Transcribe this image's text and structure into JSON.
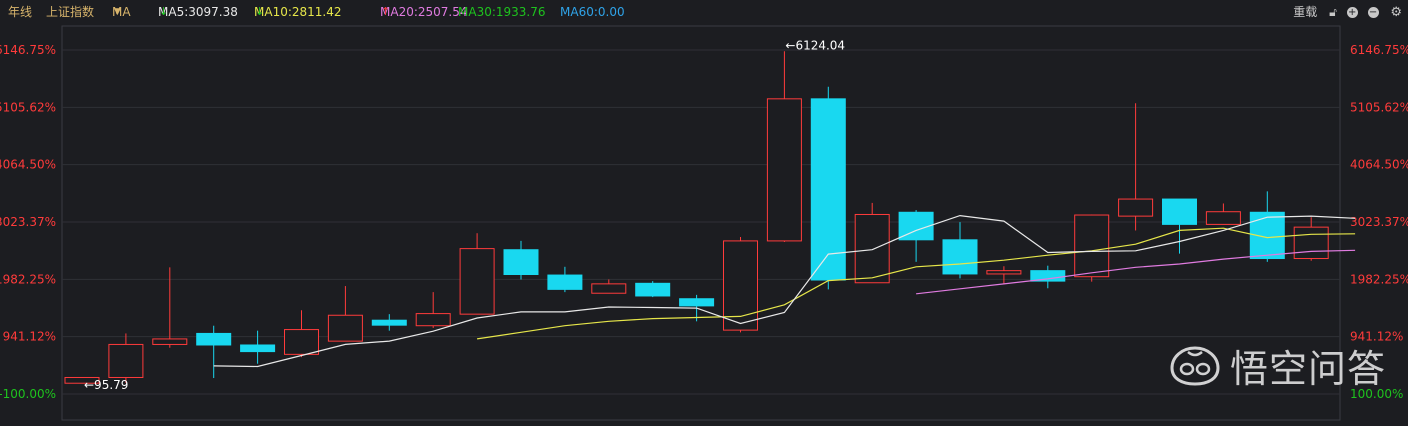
{
  "topbar": {
    "period": "年线",
    "index_name": "上证指数",
    "ma_select": "MA",
    "ma": [
      {
        "label": "MA5:3097.38",
        "arrow": "↓",
        "color": "#e8e8e8",
        "arrow_color": "#1ec31e"
      },
      {
        "label": "MA10:2811.42",
        "arrow": "↓",
        "color": "#e6e64a",
        "arrow_color": "#1ec31e"
      },
      {
        "label": "MA20:2507.54",
        "arrow": "↑",
        "color": "#e07be0",
        "arrow_color": "#ff3b3b"
      },
      {
        "label": "MA30:1933.76",
        "arrow": "",
        "color": "#1ec31e",
        "arrow_color": ""
      },
      {
        "label": "MA60:0.00",
        "arrow": "",
        "color": "#2fa3e8",
        "arrow_color": ""
      }
    ],
    "tools": {
      "reset": "重载",
      "lock_icon": "lock-icon",
      "zoom_in": "+",
      "zoom_out": "−",
      "settings_icon": "gear-icon"
    }
  },
  "watermark": "悟空问答",
  "chart_data": {
    "type": "candlestick",
    "y_ticks": [
      "6146.75%",
      "5105.62%",
      "4064.50%",
      "3023.37%",
      "1982.25%",
      "941.12%",
      "-100.00%"
    ],
    "y_ticks_right": [
      "6146.75%",
      "5105.62%",
      "4064.50%",
      "3023.37%",
      "1982.25%",
      "941.12%",
      "100.00%"
    ],
    "ylim": [
      -100,
      6146.75
    ],
    "annotations": {
      "max": "←6124.04",
      "min": "←95.79"
    },
    "colors": {
      "up": "#ff3b3b",
      "down": "#19d8f0",
      "ma5": "#e8e8e8",
      "ma10": "#e6e64a",
      "ma20": "#e07be0",
      "grid": "#2f3036",
      "axis_red": "#ff3b3b",
      "axis_green": "#1ec31e"
    },
    "candles": [
      {
        "o": 95.79,
        "h": 200,
        "l": 95.79,
        "c": 200
      },
      {
        "o": 200,
        "h": 1000,
        "l": 100,
        "c": 800
      },
      {
        "o": 800,
        "h": 2200,
        "l": 740,
        "c": 900
      },
      {
        "o": 1000,
        "h": 1140,
        "l": 190,
        "c": 790
      },
      {
        "o": 790,
        "h": 1050,
        "l": 450,
        "c": 670
      },
      {
        "o": 620,
        "h": 1420,
        "l": 570,
        "c": 1070
      },
      {
        "o": 860,
        "h": 1860,
        "l": 860,
        "c": 1330
      },
      {
        "o": 1240,
        "h": 1350,
        "l": 1050,
        "c": 1150
      },
      {
        "o": 1140,
        "h": 1750,
        "l": 1100,
        "c": 1360
      },
      {
        "o": 1350,
        "h": 2820,
        "l": 1350,
        "c": 2540
      },
      {
        "o": 2520,
        "h": 2680,
        "l": 1980,
        "c": 2070
      },
      {
        "o": 2060,
        "h": 2210,
        "l": 1750,
        "c": 1800
      },
      {
        "o": 1730,
        "h": 1980,
        "l": 1730,
        "c": 1900
      },
      {
        "o": 1910,
        "h": 1950,
        "l": 1660,
        "c": 1680
      },
      {
        "o": 1630,
        "h": 1700,
        "l": 1220,
        "c": 1500
      },
      {
        "o": 1060,
        "h": 2750,
        "l": 1020,
        "c": 2680
      },
      {
        "o": 2680,
        "h": 6124.04,
        "l": 2660,
        "c": 5260
      },
      {
        "o": 5260,
        "h": 5480,
        "l": 1800,
        "c": 1970
      },
      {
        "o": 1920,
        "h": 3370,
        "l": 1920,
        "c": 3160
      },
      {
        "o": 3200,
        "h": 3240,
        "l": 2300,
        "c": 2700
      },
      {
        "o": 2700,
        "h": 3020,
        "l": 2000,
        "c": 2080
      },
      {
        "o": 2080,
        "h": 2220,
        "l": 1900,
        "c": 2140
      },
      {
        "o": 2140,
        "h": 2230,
        "l": 1820,
        "c": 1950
      },
      {
        "o": 2030,
        "h": 3160,
        "l": 1940,
        "c": 3150
      },
      {
        "o": 3130,
        "h": 5180,
        "l": 2870,
        "c": 3440
      },
      {
        "o": 3440,
        "h": 3440,
        "l": 2450,
        "c": 2980
      },
      {
        "o": 2980,
        "h": 3360,
        "l": 2980,
        "c": 3210
      },
      {
        "o": 3200,
        "h": 3580,
        "l": 2300,
        "c": 2360
      },
      {
        "o": 2360,
        "h": 3110,
        "l": 2320,
        "c": 2930
      }
    ],
    "ma5": [
      null,
      null,
      null,
      410,
      400,
      600,
      800,
      860,
      1040,
      1280,
      1390,
      1390,
      1480,
      1470,
      1460,
      1180,
      1380,
      2440,
      2520,
      2870,
      3140,
      3040,
      2470,
      2490,
      2500,
      2670,
      2870,
      3110,
      3130,
      3090
    ],
    "ma10": [
      null,
      null,
      null,
      null,
      null,
      null,
      null,
      null,
      null,
      900,
      1020,
      1140,
      1220,
      1270,
      1290,
      1310,
      1520,
      1960,
      2010,
      2210,
      2260,
      2330,
      2420,
      2500,
      2620,
      2870,
      2910,
      2740,
      2800,
      2810
    ],
    "ma20": [
      null,
      null,
      null,
      null,
      null,
      null,
      null,
      null,
      null,
      null,
      null,
      null,
      null,
      null,
      null,
      null,
      null,
      null,
      null,
      1720,
      1810,
      1900,
      1990,
      2100,
      2200,
      2260,
      2350,
      2420,
      2490,
      2510
    ]
  }
}
